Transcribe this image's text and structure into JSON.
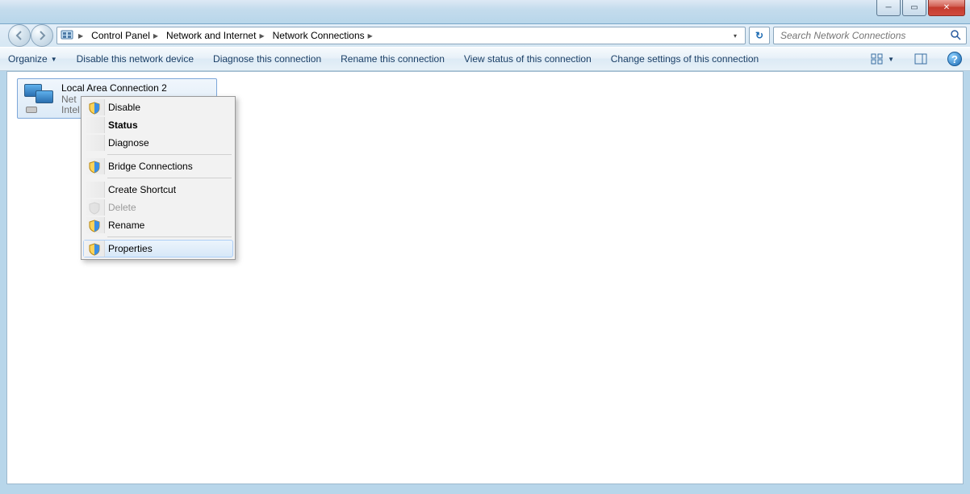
{
  "window_controls": {
    "min": "─",
    "max": "▭",
    "close": "✕"
  },
  "breadcrumbs": {
    "root_icon": "control-panel-icon",
    "items": [
      "Control Panel",
      "Network and Internet",
      "Network Connections"
    ]
  },
  "address_dropdown": "▾",
  "refresh_glyph": "↻",
  "search": {
    "placeholder": "Search Network Connections"
  },
  "toolbar": {
    "organize": "Organize",
    "disable_device": "Disable this network device",
    "diagnose": "Diagnose this connection",
    "rename": "Rename this connection",
    "view_status": "View status of this connection",
    "change_settings": "Change settings of this connection"
  },
  "connection": {
    "name": "Local Area Connection 2",
    "line2_prefix": "Net",
    "line3_prefix": "Intel"
  },
  "context_menu": {
    "disable": "Disable",
    "status": "Status",
    "diagnose": "Diagnose",
    "bridge": "Bridge Connections",
    "shortcut": "Create Shortcut",
    "delete": "Delete",
    "rename": "Rename",
    "properties": "Properties"
  }
}
